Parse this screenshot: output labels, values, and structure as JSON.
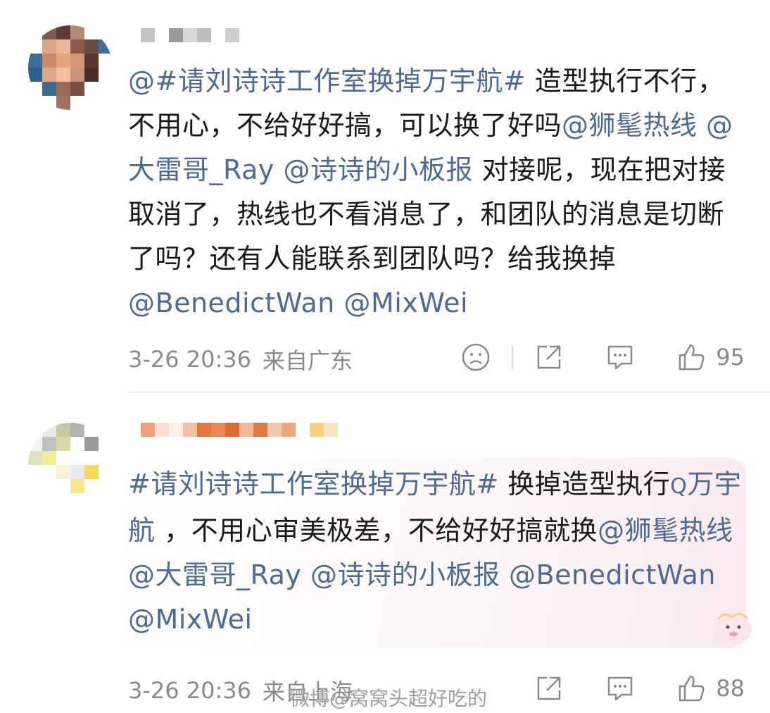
{
  "comments": [
    {
      "text_parts": [
        {
          "t": "@",
          "link": true
        },
        {
          "t": "#请刘诗诗工作室换掉万宇航#",
          "link": true
        },
        {
          "t": " 造型执行不行，不用心，不给好好搞，可以换了好吗",
          "link": false
        },
        {
          "t": "@狮髦热线",
          "link": true
        },
        {
          "t": " ",
          "link": false
        },
        {
          "t": "@大雷哥_Ray",
          "link": true
        },
        {
          "t": " ",
          "link": false
        },
        {
          "t": "@诗诗的小板报",
          "link": true
        },
        {
          "t": " 对接呢，现在把对接取消了，热线也不看消息了，和团队的消息是切断了吗？还有人能联系到团队吗？给我换掉",
          "link": false
        },
        {
          "t": "@BenedictWan",
          "link": true
        },
        {
          "t": " ",
          "link": false
        },
        {
          "t": "@MixWei",
          "link": true
        }
      ],
      "time": "3-26 20:36",
      "location": "来自广东",
      "like_count": "95",
      "has_dislike": true
    },
    {
      "text_parts": [
        {
          "t": "#请刘诗诗工作室换掉万宇航#",
          "link": true
        },
        {
          "t": " 换掉造型执行",
          "link": false
        },
        {
          "t": "Q",
          "link": true,
          "search": true
        },
        {
          "t": "万宇航",
          "link": true
        },
        {
          "t": " ，不用心审美极差，不给好好搞就换",
          "link": false
        },
        {
          "t": "@狮髦热线",
          "link": true
        },
        {
          "t": " ",
          "link": false
        },
        {
          "t": "@大雷哥_Ray",
          "link": true
        },
        {
          "t": " ",
          "link": false
        },
        {
          "t": "@诗诗的小板报",
          "link": true
        },
        {
          "t": " ",
          "link": false
        },
        {
          "t": "@BenedictWan",
          "link": true
        },
        {
          "t": " ",
          "link": false
        },
        {
          "t": "@MixWei",
          "link": true
        }
      ],
      "time": "3-26 20:36",
      "location": "来自上海",
      "like_count": "88",
      "has_dislike": false
    }
  ],
  "watermark": "微博@窝窝头超好吃的",
  "colors": {
    "link": "#4c6a97",
    "meta": "#8a8a8a"
  },
  "icons": [
    "dislike-icon",
    "share-icon",
    "comment-icon",
    "like-icon",
    "search-icon"
  ]
}
